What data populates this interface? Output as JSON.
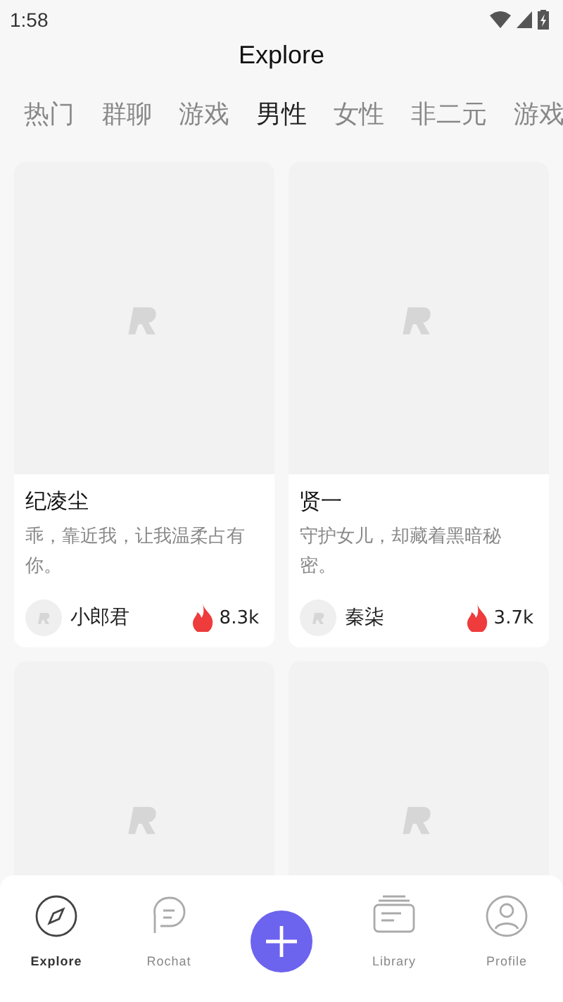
{
  "status_bar": {
    "time": "1:58"
  },
  "header": {
    "title": "Explore"
  },
  "tabs": [
    {
      "label": "热门",
      "selected": false
    },
    {
      "label": "群聊",
      "selected": false
    },
    {
      "label": "游戏",
      "selected": false
    },
    {
      "label": "男性",
      "selected": true
    },
    {
      "label": "女性",
      "selected": false
    },
    {
      "label": "非二元",
      "selected": false
    },
    {
      "label": "游戏",
      "selected": false
    }
  ],
  "cards": [
    {
      "kind": "full",
      "name": "纪凌尘",
      "description": "乖，靠近我，让我温柔占有你。",
      "author": "小郎君",
      "heat": "8.3k"
    },
    {
      "kind": "full",
      "name": "贤一",
      "description": "守护女儿，却藏着黑暗秘密。",
      "author": "秦柒",
      "heat": "3.7k"
    },
    {
      "kind": "picture"
    },
    {
      "kind": "picture"
    }
  ],
  "nav": [
    {
      "kind": "compass",
      "label": "Explore",
      "selected": true
    },
    {
      "kind": "chat",
      "label": "Rochat",
      "selected": false
    },
    {
      "kind": "create"
    },
    {
      "kind": "library",
      "label": "Library",
      "selected": false
    },
    {
      "kind": "profile",
      "label": "Profile",
      "selected": false
    }
  ]
}
